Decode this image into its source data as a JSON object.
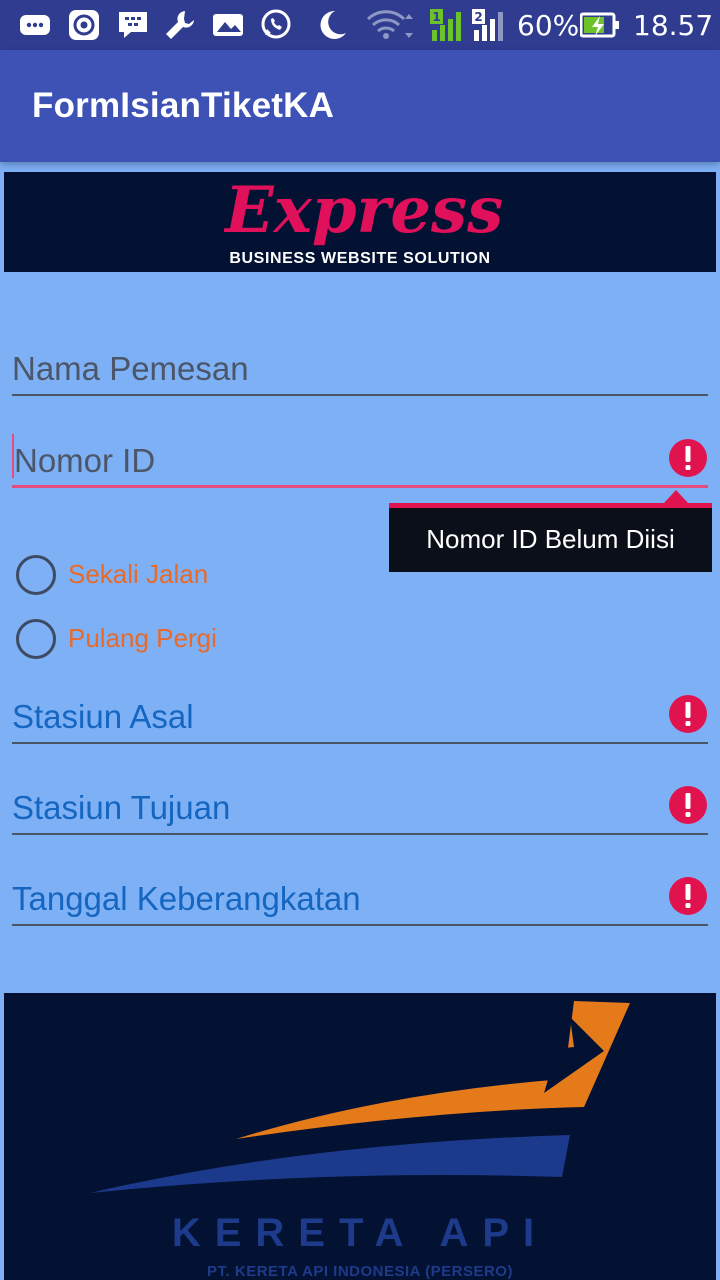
{
  "status_bar": {
    "battery": "60%",
    "time": "18.57",
    "icons": [
      "message-icon",
      "target-icon",
      "bbm-icon",
      "wrench-icon",
      "image-icon",
      "whatsapp-icon",
      "moon-icon",
      "wifi-icon",
      "signal-1-icon",
      "signal-2-icon",
      "battery-charging-icon"
    ]
  },
  "app_bar": {
    "title": "FormIsianTiketKA"
  },
  "banner": {
    "logo_text": "Express",
    "tagline": "BUSINESS WEBSITE SOLUTION"
  },
  "form": {
    "nama": {
      "hint": "Nama Pemesan"
    },
    "nomor_id": {
      "hint": "Nomor ID",
      "error_tooltip": "Nomor ID Belum Diisi"
    },
    "trip_type": {
      "options": [
        "Sekali Jalan",
        "Pulang Pergi"
      ]
    },
    "stasiun_asal": {
      "hint": "Stasiun Asal"
    },
    "stasiun_tujuan": {
      "hint": "Stasiun Tujuan"
    },
    "tanggal": {
      "hint": "Tanggal Keberangkatan"
    }
  },
  "footer_logo": {
    "title": "KERETA API",
    "subtitle": "PT. KERETA API INDONESIA (PERSERO)"
  },
  "colors": {
    "status_bar": "#2f3c8f",
    "app_bar": "#3e51b5",
    "background": "#7eb0f6",
    "error": "#e0134f",
    "accent_orange": "#e76a2a",
    "hint_blue": "#1566c0"
  }
}
